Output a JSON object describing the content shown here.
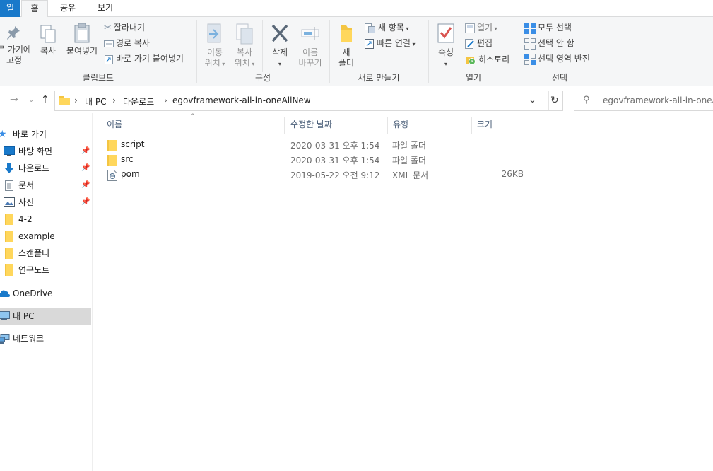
{
  "tabs": {
    "file": "일",
    "home": "홈",
    "share": "공유",
    "view": "보기"
  },
  "ribbon": {
    "clipboard": {
      "pin_line1": "르 가기에",
      "pin_line2": "고정",
      "copy": "복사",
      "paste": "붙여넣기",
      "cut": "잘라내기",
      "copy_path": "경로 복사",
      "paste_shortcut": "바로 가기 붙여넣기",
      "label": "클립보드"
    },
    "organize": {
      "move_line1": "이동",
      "move_line2": "위치",
      "copyto_line1": "복사",
      "copyto_line2": "위치",
      "delete": "삭제",
      "rename_line1": "이름",
      "rename_line2": "바꾸기",
      "label": "구성"
    },
    "new": {
      "folder_line1": "새",
      "folder_line2": "폴더",
      "new_item": "새 항목",
      "easy_access": "빠른 연결",
      "label": "새로 만들기"
    },
    "open": {
      "properties": "속성",
      "open": "열기",
      "edit": "편집",
      "history": "히스토리",
      "label": "열기"
    },
    "select": {
      "select_all": "모두 선택",
      "select_none": "선택 안 함",
      "invert": "선택 영역 반전",
      "label": "선택"
    }
  },
  "address": {
    "crumb1": "내 PC",
    "crumb2": "다운로드",
    "crumb3": "egovframework-all-in-oneAllNew",
    "search_placeholder": "egovframework-all-in-oneAllN"
  },
  "nav": {
    "quick_access": "바로 가기",
    "desktop": "바탕 화면",
    "downloads": "다운로드",
    "documents": "문서",
    "pictures": "사진",
    "folder1": "4-2",
    "folder2": "example",
    "folder3": "스캔폴더",
    "folder4": "연구노트",
    "onedrive": "OneDrive",
    "this_pc": "내 PC",
    "network": "네트워크"
  },
  "columns": {
    "name": "이름",
    "modified": "수정한 날짜",
    "type": "유형",
    "size": "크기"
  },
  "files": [
    {
      "name": "script",
      "modified": "2020-03-31 오후 1:54",
      "type": "파일 폴더",
      "size": ""
    },
    {
      "name": "src",
      "modified": "2020-03-31 오후 1:54",
      "type": "파일 폴더",
      "size": ""
    },
    {
      "name": "pom",
      "modified": "2019-05-22 오전 9:12",
      "type": "XML 문서",
      "size": "26KB"
    }
  ],
  "colors": {
    "accent": "#1979ca",
    "folder": "#f4c542",
    "selected_bg": "#d9d9d9"
  }
}
